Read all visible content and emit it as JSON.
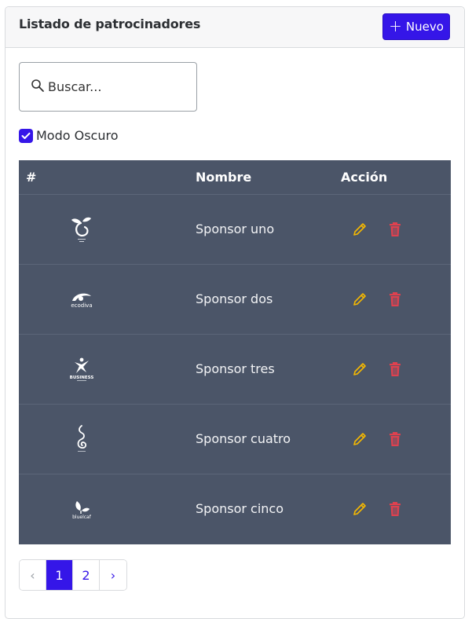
{
  "header": {
    "title": "Listado de patrocinadores",
    "new_button_label": "Nuevo"
  },
  "search": {
    "placeholder": "Buscar...",
    "icon": "search-icon"
  },
  "dark_mode": {
    "label": "Modo Oscuro",
    "checked": true
  },
  "table": {
    "columns": [
      "#",
      "Nombre",
      "Acción"
    ],
    "rows": [
      {
        "logo": "sprout-logo",
        "logo_text": "",
        "name": "Sponsor uno"
      },
      {
        "logo": "ecodiva-logo",
        "logo_text": "ecodiva",
        "name": "Sponsor dos"
      },
      {
        "logo": "business-logo",
        "logo_text": "BUSINESS",
        "name": "Sponsor tres"
      },
      {
        "logo": "swirl-logo",
        "logo_text": "",
        "name": "Sponsor cuatro"
      },
      {
        "logo": "bluelcaf-logo",
        "logo_text": "bluelcaf",
        "name": "Sponsor cinco"
      }
    ]
  },
  "pagination": {
    "prev": "‹",
    "pages": [
      "1",
      "2"
    ],
    "next": "›",
    "current": "1"
  },
  "colors": {
    "primary": "#3516e8",
    "table_bg": "#4b5568",
    "edit": "#f5b800",
    "delete": "#e0414f"
  }
}
